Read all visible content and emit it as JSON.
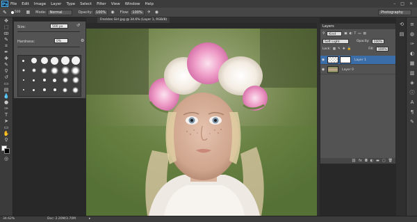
{
  "app": {
    "logo": "Ps"
  },
  "menu": [
    "File",
    "Edit",
    "Image",
    "Layer",
    "Type",
    "Select",
    "Filter",
    "View",
    "Window",
    "Help"
  ],
  "window_controls": [
    "–",
    "□",
    "✕"
  ],
  "options": {
    "brush_size": "500",
    "mode_label": "Mode:",
    "mode_value": "Normal",
    "opacity_label": "Opacity:",
    "opacity_value": "100%",
    "flow_label": "Flow:",
    "flow_value": "100%",
    "workspace": "Photography"
  },
  "brush_panel": {
    "size_label": "Size:",
    "size_value": "500 px",
    "hardness_label": "Hardness:",
    "hardness_value": "0%"
  },
  "document_tab": {
    "title": "Freckles Girl.jpg @ 34.6% (Layer 1, RGB/8)"
  },
  "layers_panel": {
    "title": "Layers",
    "kind_label": "Kind",
    "blend_mode": "Soft Light",
    "opacity_label": "Opacity:",
    "opacity_value": "100%",
    "lock_label": "Lock:",
    "fill_label": "Fill:",
    "fill_value": "100%",
    "layers": [
      {
        "name": "Layer 1",
        "selected": true
      },
      {
        "name": "Layer 0",
        "selected": false
      }
    ],
    "footer_icons": [
      "link-icon",
      "fx-icon",
      "mask-icon",
      "adjustment-icon",
      "folder-icon",
      "new-layer-icon",
      "trash-icon"
    ]
  },
  "status": {
    "zoom": "34.62%",
    "doc_info": "Doc: 2.20M/3.70M"
  }
}
